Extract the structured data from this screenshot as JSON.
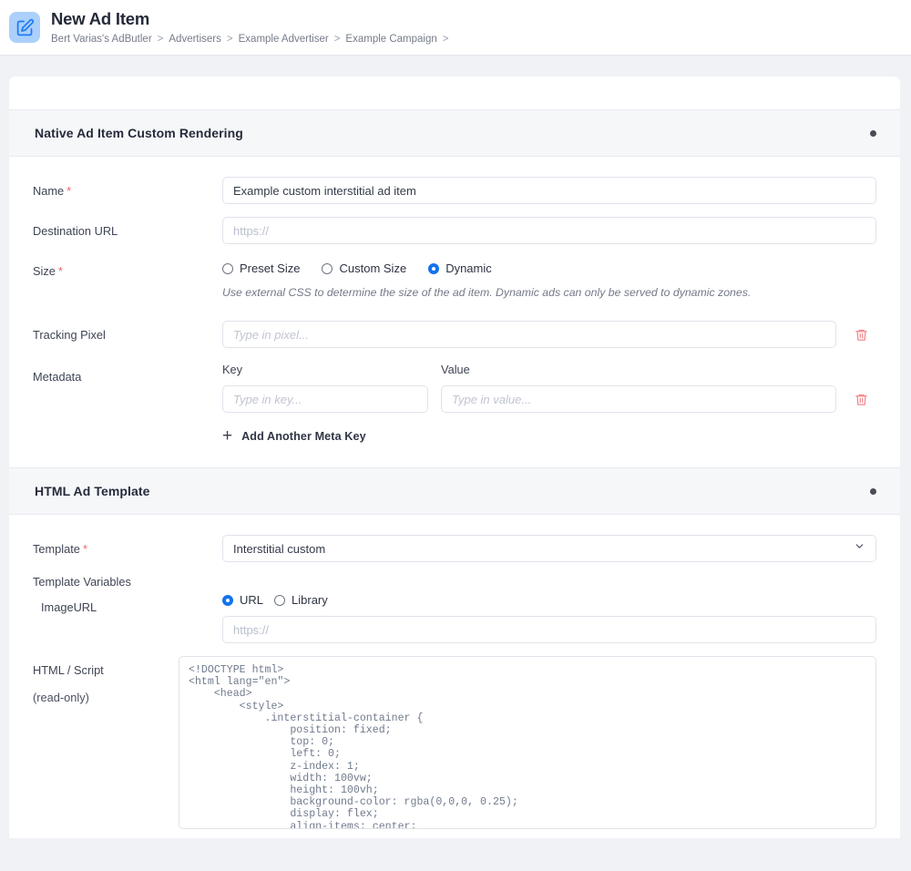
{
  "header": {
    "icon": "edit-square-icon",
    "title": "New Ad Item",
    "breadcrumb": [
      "Bert Varias's AdButler",
      "Advertisers",
      "Example Advertiser",
      "Example Campaign",
      ""
    ],
    "separator": ">"
  },
  "sections": [
    {
      "title": "Native Ad Item Custom Rendering",
      "collapse_icon": "collapse-dot-icon"
    },
    {
      "title": "HTML Ad Template",
      "collapse_icon": "collapse-dot-icon"
    }
  ],
  "native": {
    "name_label": "Name",
    "name_value": "Example custom interstitial ad item",
    "destination_label": "Destination URL",
    "destination_placeholder": "https://",
    "destination_value": "",
    "size_label": "Size",
    "size_options": [
      {
        "label": "Preset Size",
        "selected": false
      },
      {
        "label": "Custom Size",
        "selected": false
      },
      {
        "label": "Dynamic",
        "selected": true
      }
    ],
    "size_help": "Use external CSS to determine the size of the ad item. Dynamic ads can only be served to dynamic zones.",
    "tracking_label": "Tracking Pixel",
    "tracking_placeholder": "Type in pixel...",
    "tracking_value": "",
    "tracking_delete_icon": "trash-icon",
    "metadata_label": "Metadata",
    "metadata_key_header": "Key",
    "metadata_value_header": "Value",
    "metadata_key_placeholder": "Type in key...",
    "metadata_value_placeholder": "Type in value...",
    "metadata_key_value": "",
    "metadata_value_value": "",
    "metadata_delete_icon": "trash-icon",
    "add_meta_icon": "plus-icon",
    "add_meta_label": "Add Another Meta Key"
  },
  "html_template": {
    "template_label": "Template",
    "template_value": "Interstitial custom",
    "template_chevron": "chevron-down-icon",
    "variables_label": "Template Variables",
    "image_url_label": "ImageURL",
    "image_url_options": [
      {
        "label": "URL",
        "selected": true
      },
      {
        "label": "Library",
        "selected": false
      }
    ],
    "image_url_placeholder": "https://",
    "image_url_value": "",
    "script_label": "HTML / Script",
    "script_readonly_note": "(read-only)",
    "script_code": "<!DOCTYPE html>\n<html lang=\"en\">\n    <head>\n        <style>\n            .interstitial-container {\n                position: fixed;\n                top: 0;\n                left: 0;\n                z-index: 1;\n                width: 100vw;\n                height: 100vh;\n                background-color: rgba(0,0,0, 0.25);\n                display: flex;\n                align-items: center;"
  },
  "colors": {
    "accent": "#1273ec",
    "required": "#f4616b",
    "danger": "#f2888c",
    "page_bg": "#f1f2f6",
    "section_bg": "#f6f7f9",
    "icon_bg": "#abd0fb"
  }
}
